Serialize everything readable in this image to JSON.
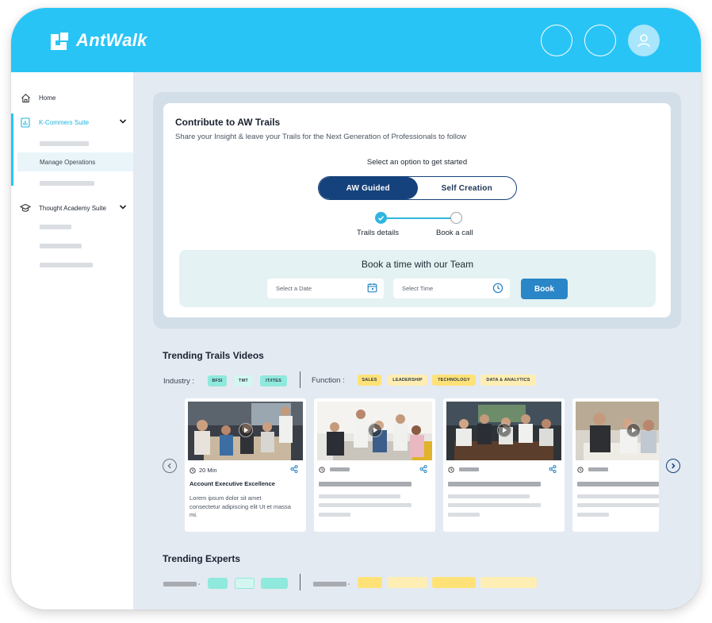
{
  "app": {
    "name": "AntWalk"
  },
  "header": {
    "buttons": [
      "circle-button",
      "circle-button",
      "user-icon"
    ]
  },
  "sidebar": {
    "items": [
      {
        "label": "Home",
        "icon": "home-icon"
      },
      {
        "label": "K-Commers Suite",
        "icon": "chart-icon",
        "active": true
      },
      {
        "label": "Manage Operations"
      },
      {
        "label": "Thought Academy Suite",
        "icon": "graduation-cap-icon"
      }
    ]
  },
  "contribute": {
    "title": "Contribute to AW Trails",
    "subtitle": "Share your Insight & leave your Trails for the Next Generation of Professionals to follow",
    "select_label": "Select an option to get started",
    "toggle": {
      "option_1": "AW Guided",
      "option_2": "Self Creation",
      "selected": "AW Guided"
    },
    "steps": [
      "Trails details",
      "Book a call"
    ],
    "book": {
      "title": "Book a time with our Team",
      "date_placeholder": "Select a Date",
      "time_placeholder": "Select Time",
      "button": "Book"
    }
  },
  "trending_videos": {
    "title": "Trending Trails Videos",
    "industry_label": "Industry :",
    "industries": [
      "BFSI",
      "TMT",
      "IT/ITES"
    ],
    "function_label": "Function :",
    "functions": [
      "SALES",
      "LEADERSHIP",
      "TECHNOLOGY",
      "DATA & ANALYTICS"
    ],
    "cards": [
      {
        "duration": "20 Min",
        "title": "Account Executive Excellence",
        "description": "Lorem ipsum dolor sit amet consectetur adipiscing elit Ut et massa mi."
      }
    ]
  },
  "trending_experts": {
    "title": "Trending Experts"
  },
  "colors": {
    "header": "#29c4f6",
    "primary_dark": "#15427c",
    "button": "#2a86c7",
    "accent": "#2fb6e0"
  }
}
